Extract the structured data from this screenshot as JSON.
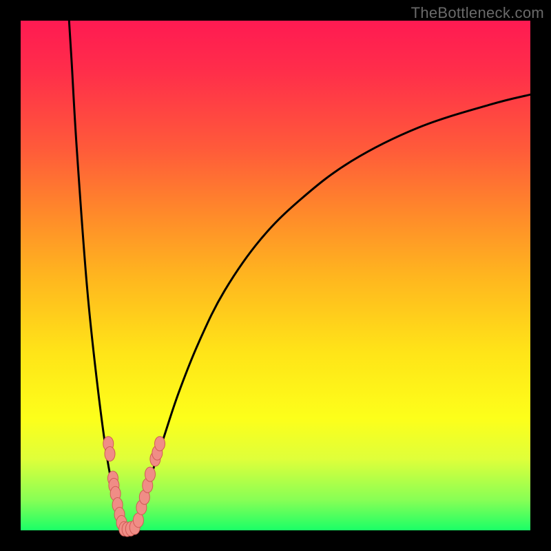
{
  "watermark": "TheBottleneck.com",
  "colors": {
    "frame": "#000000",
    "curve": "#000000",
    "marker_fill": "#f08d86",
    "marker_stroke": "#d05a55",
    "gradient_top": "#ff1a52",
    "gradient_bottom": "#1aff67"
  },
  "chart_data": {
    "type": "line",
    "title": "",
    "xlabel": "",
    "ylabel": "",
    "xlim": [
      0,
      100
    ],
    "ylim": [
      0,
      100
    ],
    "grid": false,
    "legend": false,
    "series": [
      {
        "name": "left-curve",
        "x": [
          9.5,
          10,
          11,
          13,
          15,
          17,
          18.5,
          19.5,
          20,
          20.5
        ],
        "values": [
          100,
          92,
          75,
          48,
          29,
          14,
          6.5,
          2.5,
          1,
          0
        ]
      },
      {
        "name": "right-curve",
        "x": [
          22,
          23,
          24,
          26,
          28,
          31,
          35,
          40,
          47,
          55,
          65,
          78,
          92,
          100
        ],
        "values": [
          0,
          2.5,
          6,
          12,
          18,
          27,
          37,
          47,
          57,
          65,
          72.5,
          79,
          83.5,
          85.5
        ]
      }
    ],
    "markers": {
      "left_cluster": [
        {
          "x": 17.2,
          "y": 17.0
        },
        {
          "x": 17.5,
          "y": 15.0
        },
        {
          "x": 18.1,
          "y": 10.2
        },
        {
          "x": 18.3,
          "y": 8.8
        },
        {
          "x": 18.6,
          "y": 7.2
        },
        {
          "x": 19.0,
          "y": 5.0
        },
        {
          "x": 19.4,
          "y": 3.1
        },
        {
          "x": 19.8,
          "y": 1.5
        }
      ],
      "bottom_cluster": [
        {
          "x": 20.3,
          "y": 0.3
        },
        {
          "x": 20.9,
          "y": 0.2
        },
        {
          "x": 21.6,
          "y": 0.3
        },
        {
          "x": 22.4,
          "y": 0.6
        }
      ],
      "right_cluster": [
        {
          "x": 23.1,
          "y": 2.0
        },
        {
          "x": 23.7,
          "y": 4.5
        },
        {
          "x": 24.3,
          "y": 6.5
        },
        {
          "x": 24.9,
          "y": 8.8
        },
        {
          "x": 25.4,
          "y": 11.0
        },
        {
          "x": 26.4,
          "y": 14.0
        },
        {
          "x": 26.8,
          "y": 15.2
        },
        {
          "x": 27.3,
          "y": 17.0
        }
      ]
    }
  }
}
